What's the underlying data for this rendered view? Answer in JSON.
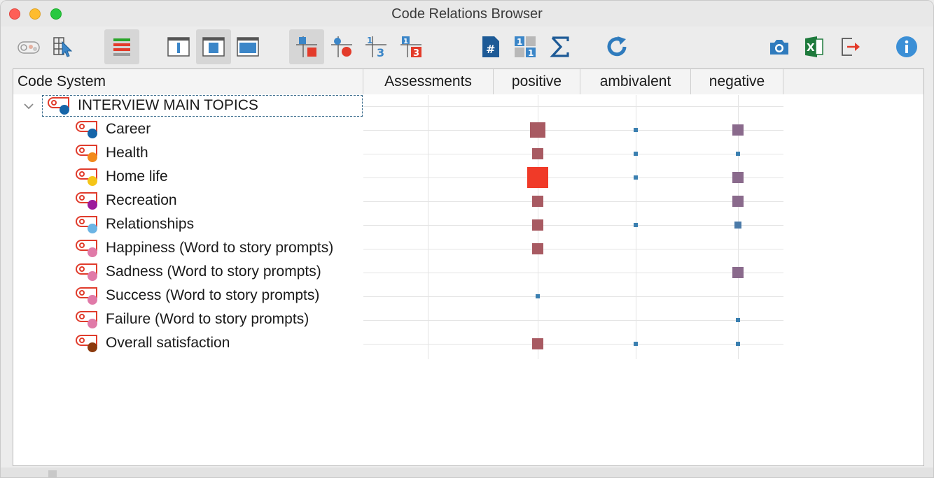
{
  "window": {
    "title": "Code Relations Browser"
  },
  "toolbar": {
    "buttons": [
      {
        "name": "toggle-view-button",
        "icon": "codes-toggle-icon"
      },
      {
        "name": "select-pointer-button",
        "icon": "grid-pointer-icon"
      },
      {
        "name": "display-bars-button",
        "icon": "color-bars-icon",
        "active": true
      },
      {
        "name": "layout-narrow-button",
        "icon": "window-narrow-icon"
      },
      {
        "name": "layout-medium-button",
        "icon": "window-medium-icon",
        "active": true
      },
      {
        "name": "layout-wide-button",
        "icon": "window-wide-icon"
      },
      {
        "name": "symbol-squares-button",
        "icon": "squares-symbol-icon",
        "active": true
      },
      {
        "name": "symbol-circles-button",
        "icon": "circles-symbol-icon"
      },
      {
        "name": "symbol-numbers-button",
        "icon": "numbers-symbol-icon"
      },
      {
        "name": "symbol-heatmap-numbers-button",
        "icon": "heatmap-numbers-icon"
      },
      {
        "name": "hash-button",
        "icon": "hash-document-icon"
      },
      {
        "name": "binary-button",
        "icon": "binary-grid-icon"
      },
      {
        "name": "sum-button",
        "icon": "sigma-icon"
      },
      {
        "name": "refresh-button",
        "icon": "refresh-icon"
      },
      {
        "name": "screenshot-button",
        "icon": "camera-icon"
      },
      {
        "name": "excel-export-button",
        "icon": "excel-icon"
      },
      {
        "name": "export-button",
        "icon": "export-arrow-icon"
      },
      {
        "name": "info-button",
        "icon": "info-icon"
      }
    ]
  },
  "table": {
    "columns": [
      "Code System",
      "Assessments",
      "positive",
      "ambivalent",
      "negative"
    ],
    "root": {
      "label": "INTERVIEW MAIN TOPICS",
      "dot_color": "#1565a8"
    },
    "rows": [
      {
        "label": "Career",
        "dot_color": "#1565a8",
        "positive": 3,
        "ambivalent": 1,
        "negative": 2
      },
      {
        "label": "Health",
        "dot_color": "#f28a1c",
        "positive": 2,
        "ambivalent": 1,
        "negative": 1
      },
      {
        "label": "Home life",
        "dot_color": "#f5c518",
        "positive": 4,
        "ambivalent": 1,
        "negative": 2
      },
      {
        "label": "Recreation",
        "dot_color": "#9b1a9b",
        "positive": 2,
        "ambivalent": 0,
        "negative": 2
      },
      {
        "label": "Relationships",
        "dot_color": "#6cb4e4",
        "positive": 2,
        "ambivalent": 1,
        "negative": 1.5
      },
      {
        "label": "Happiness (Word to story prompts)",
        "dot_color": "#e07aa8",
        "positive": 2,
        "ambivalent": 0,
        "negative": 0
      },
      {
        "label": "Sadness (Word to story prompts)",
        "dot_color": "#e07aa8",
        "positive": 0,
        "ambivalent": 0,
        "negative": 2
      },
      {
        "label": "Success (Word to story prompts)",
        "dot_color": "#e07aa8",
        "positive": 1,
        "ambivalent": 0,
        "negative": 0
      },
      {
        "label": "Failure (Word to story prompts)",
        "dot_color": "#e07aa8",
        "positive": 0,
        "ambivalent": 0,
        "negative": 1
      },
      {
        "label": "Overall satisfaction",
        "dot_color": "#8b3a0e",
        "positive": 2,
        "ambivalent": 1,
        "negative": 1
      }
    ]
  },
  "colors": {
    "small": "#3a7fb0",
    "medium_positive": "#a85a62",
    "medium_negative": "#8a6a8c",
    "large": "#f03a28",
    "blue_small": "#4a7aa8"
  }
}
